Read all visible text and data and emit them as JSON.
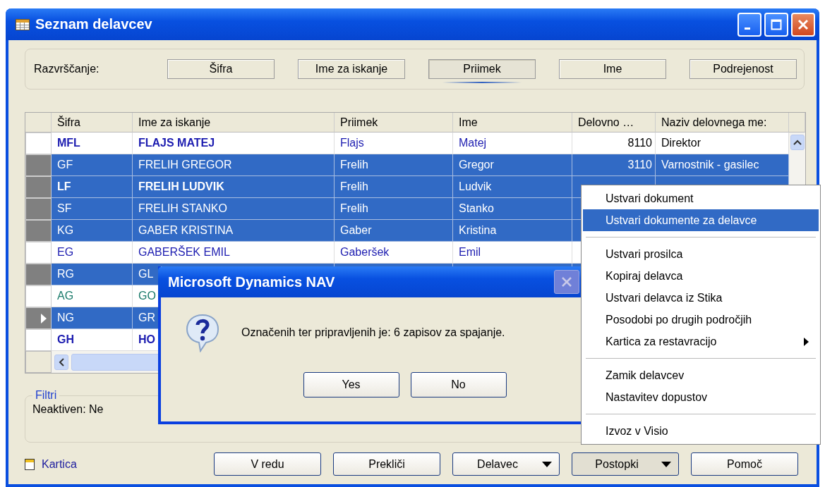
{
  "window": {
    "title": "Seznam delavcev"
  },
  "sort": {
    "label": "Razvrščanje:",
    "buttons": [
      {
        "label": "Šifra",
        "selected": false
      },
      {
        "label": "Ime za iskanje",
        "selected": false
      },
      {
        "label": "Priimek",
        "selected": true
      },
      {
        "label": "Ime",
        "selected": false
      },
      {
        "label": "Podrejenost",
        "selected": false
      }
    ]
  },
  "table": {
    "columns": [
      "Šifra",
      "Ime za iskanje",
      "Priimek",
      "Ime",
      "Delovno …",
      "Naziv delovnega me:"
    ],
    "rows": [
      {
        "cells": [
          "MFL",
          "FLAJS MATEJ",
          "Flajs",
          "Matej",
          "8110",
          "Direktor"
        ],
        "selected": false,
        "bold": true,
        "current": false,
        "color": "#1c1cb0"
      },
      {
        "cells": [
          "GF",
          "FRELIH GREGOR",
          "Frelih",
          "Gregor",
          "3110",
          "Varnostnik - gasilec"
        ],
        "selected": true,
        "bold": false,
        "current": false
      },
      {
        "cells": [
          "LF",
          "FRELIH LUDVIK",
          "Frelih",
          "Ludvik"
        ],
        "selected": true,
        "bold": true,
        "current": false
      },
      {
        "cells": [
          "SF",
          "FRELIH STANKO",
          "Frelih",
          "Stanko"
        ],
        "selected": true,
        "bold": false,
        "current": false
      },
      {
        "cells": [
          "KG",
          "GABER KRISTINA",
          "Gaber",
          "Kristina"
        ],
        "selected": true,
        "bold": false,
        "current": false
      },
      {
        "cells": [
          "EG",
          "GABERŠEK EMIL",
          "Gaberšek",
          "Emil"
        ],
        "selected": false,
        "bold": false,
        "current": false,
        "color": "#1c1cb0"
      },
      {
        "cells": [
          "RG",
          "GL"
        ],
        "selected": true,
        "bold": false,
        "current": false
      },
      {
        "cells": [
          "AG",
          "GO"
        ],
        "selected": false,
        "bold": false,
        "current": false,
        "color": "#1a7a6a"
      },
      {
        "cells": [
          "NG",
          "GR"
        ],
        "selected": true,
        "bold": false,
        "current": true
      },
      {
        "cells": [
          "GH",
          "HO"
        ],
        "selected": false,
        "bold": true,
        "current": false,
        "color": "#1c1cb0"
      }
    ]
  },
  "filters": {
    "title": "Filtri",
    "text": "Neaktiven: Ne"
  },
  "footer": {
    "link": "Kartica",
    "buttons": [
      {
        "label": "V redu",
        "dropdown": false,
        "pressed": false
      },
      {
        "label": "Prekliči",
        "dropdown": false,
        "pressed": false
      },
      {
        "label": "Delavec",
        "dropdown": true,
        "pressed": false
      },
      {
        "label": "Postopki",
        "dropdown": true,
        "pressed": true
      },
      {
        "label": "Pomoč",
        "dropdown": false,
        "pressed": false
      }
    ]
  },
  "dialog": {
    "title": "Microsoft Dynamics NAV",
    "message": "Označenih ter pripravljenih je: 6 zapisov za spajanje.",
    "buttons": [
      "Yes",
      "No"
    ]
  },
  "menu": {
    "items": [
      {
        "kind": "item",
        "label": "Ustvari dokument",
        "selected": false,
        "submenu": false
      },
      {
        "kind": "item",
        "label": "Ustvari dokumente za delavce",
        "selected": true,
        "submenu": false
      },
      {
        "kind": "separator"
      },
      {
        "kind": "item",
        "label": "Ustvari prosilca",
        "selected": false,
        "submenu": false
      },
      {
        "kind": "item",
        "label": "Kopiraj delavca",
        "selected": false,
        "submenu": false
      },
      {
        "kind": "item",
        "label": "Ustvari delavca iz Stika",
        "selected": false,
        "submenu": false
      },
      {
        "kind": "item",
        "label": "Posodobi po drugih področjih",
        "selected": false,
        "submenu": false
      },
      {
        "kind": "item",
        "label": "Kartica za restavracijo",
        "selected": false,
        "submenu": true
      },
      {
        "kind": "separator"
      },
      {
        "kind": "item",
        "label": "Zamik delavcev",
        "selected": false,
        "submenu": false
      },
      {
        "kind": "item",
        "label": "Nastavitev dopustov",
        "selected": false,
        "submenu": false
      },
      {
        "kind": "separator"
      },
      {
        "kind": "item",
        "label": "Izvoz v Visio",
        "selected": false,
        "submenu": false
      }
    ]
  }
}
